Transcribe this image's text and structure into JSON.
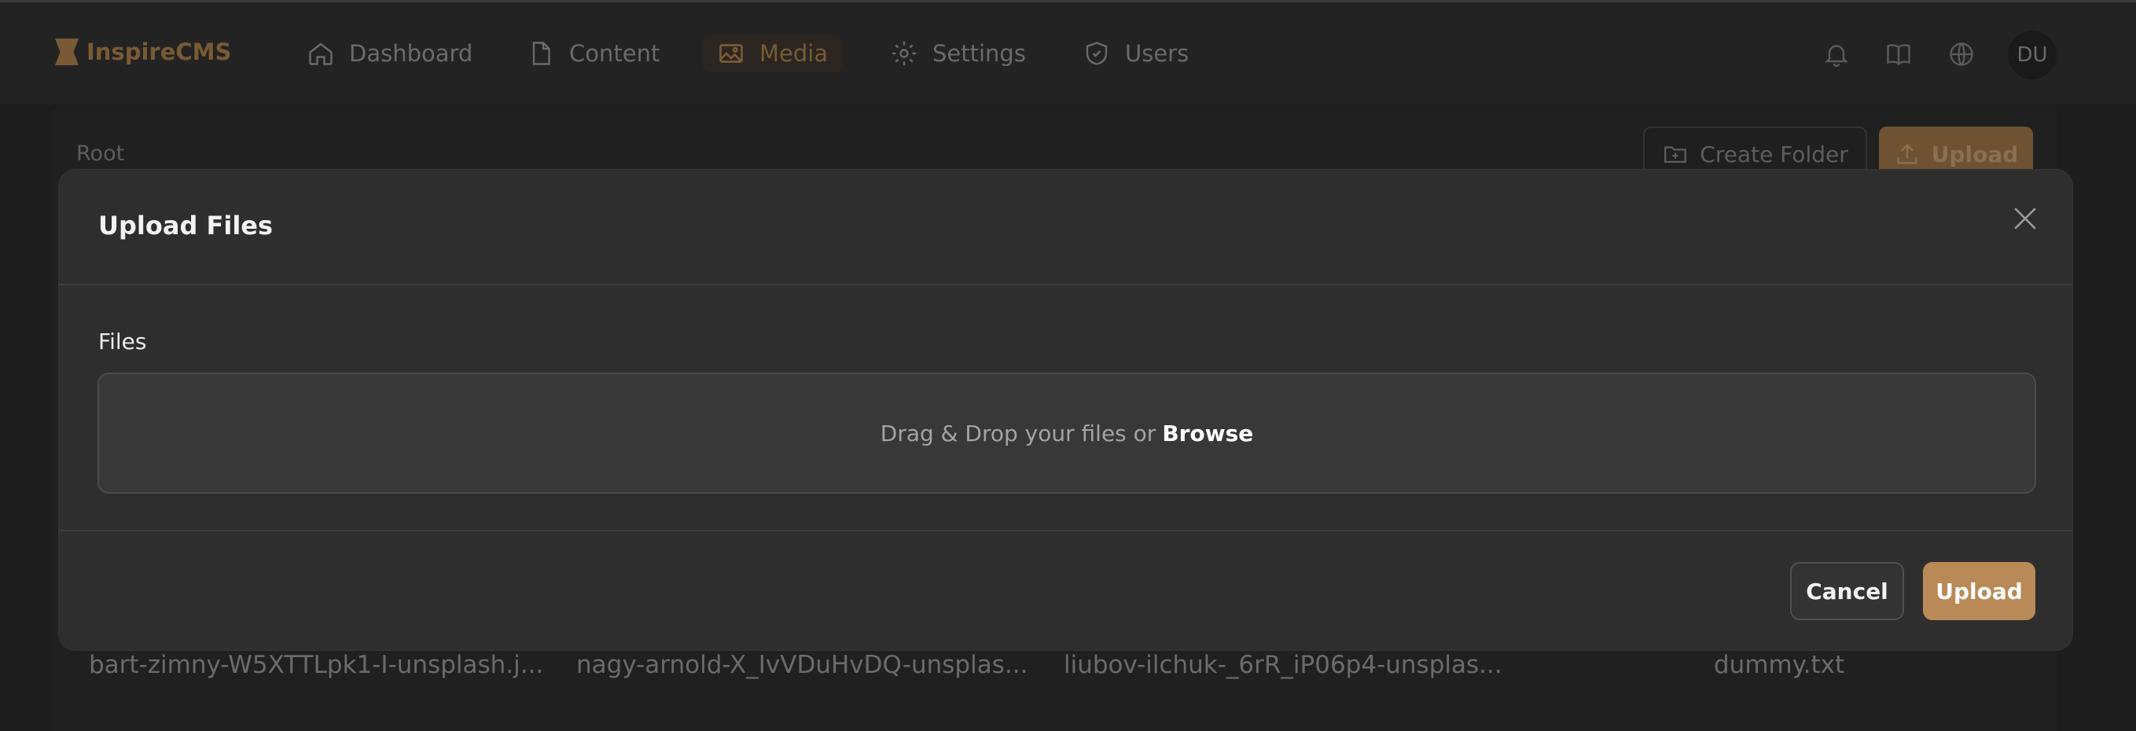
{
  "app": {
    "name": "InspireCMS",
    "avatar_initials": "DU"
  },
  "nav": [
    {
      "label": "Dashboard",
      "icon": "home-icon"
    },
    {
      "label": "Content",
      "icon": "document-icon"
    },
    {
      "label": "Media",
      "icon": "image-icon",
      "active": true
    },
    {
      "label": "Settings",
      "icon": "gear-icon"
    },
    {
      "label": "Users",
      "icon": "shield-icon"
    }
  ],
  "header_icons": [
    "bell-icon",
    "book-icon",
    "globe-icon"
  ],
  "media": {
    "breadcrumb": "Root",
    "create_folder_label": "Create Folder",
    "upload_label": "Upload",
    "files": [
      "bart-zimny-W5XTTLpk1-I-unsplash.j...",
      "nagy-arnold-X_IvVDuHvDQ-unsplas...",
      "liubov-ilchuk-_6rR_iP06p4-unsplas...",
      "dummy.txt"
    ]
  },
  "modal": {
    "title": "Upload Files",
    "field_label": "Files",
    "dropzone_text": "Drag & Drop your files or",
    "browse_label": "Browse",
    "cancel_label": "Cancel",
    "upload_label": "Upload"
  },
  "colors": {
    "accent": "#b98a57",
    "modal_bg": "#2e2e2e",
    "page_bg": "#1d1d1d"
  }
}
